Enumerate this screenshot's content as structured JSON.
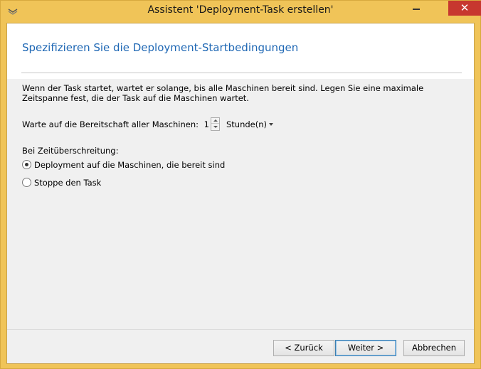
{
  "window": {
    "title": "Assistent 'Deployment-Task erstellen'",
    "close_glyph": "✕"
  },
  "header": {
    "title": "Spezifizieren Sie die Deployment-Startbedingungen"
  },
  "content": {
    "description": "Wenn der Task startet, wartet er solange, bis alle Maschinen bereit sind. Legen Sie eine maximale Zeitspanne fest, die der Task auf die Maschinen wartet.",
    "wait_label": "Warte auf die Bereitschaft aller Maschinen:",
    "wait_value": "1",
    "wait_unit": "Stunde(n)",
    "timeout_label": "Bei Zeitüberschreitung:",
    "options": [
      {
        "label": "Deployment auf die Maschinen, die bereit sind",
        "checked": true
      },
      {
        "label": "Stoppe den Task",
        "checked": false
      }
    ]
  },
  "buttons": {
    "back": "< Zurück",
    "next": "Weiter >",
    "cancel": "Abbrechen"
  },
  "colors": {
    "title_bar": "#f0c458",
    "header_title": "#1e67b4",
    "close_button": "#c7372f"
  }
}
